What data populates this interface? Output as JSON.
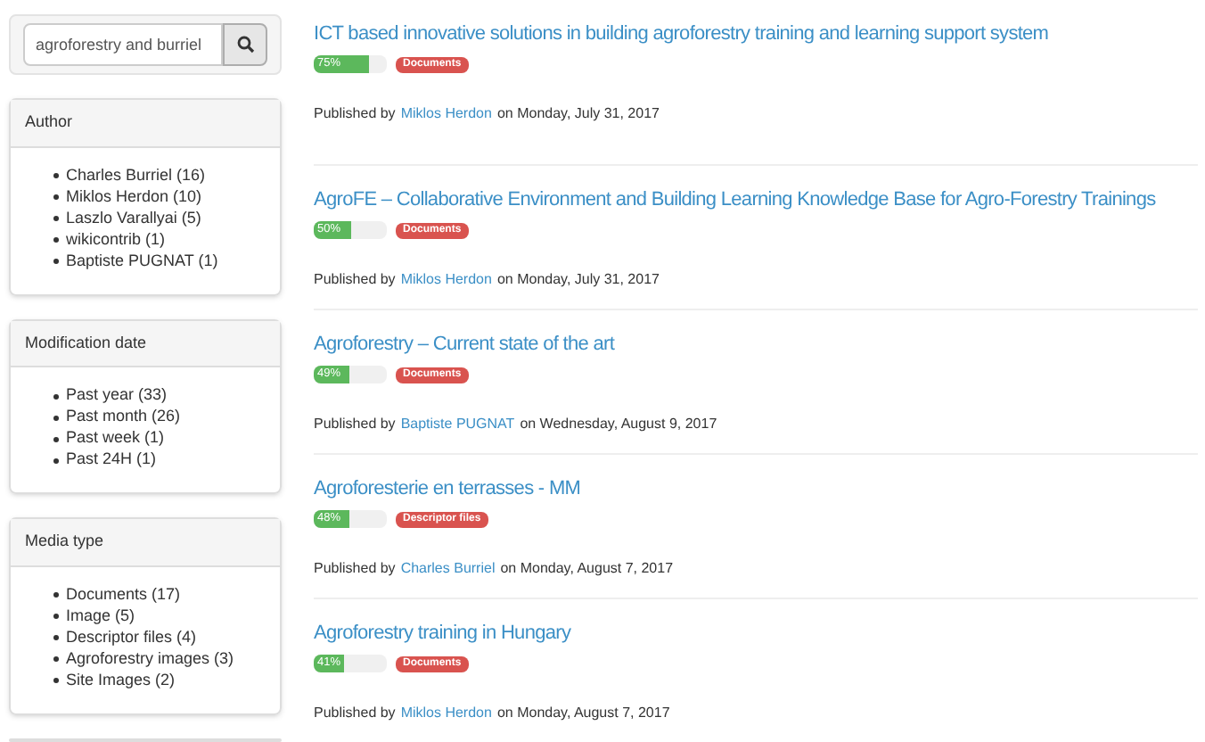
{
  "search": {
    "value": "agroforestry and burriel"
  },
  "facets": [
    {
      "title": "Author",
      "items": [
        "Charles Burriel (16)",
        "Miklos Herdon (10)",
        "Laszlo Varallyai (5)",
        "wikicontrib (1)",
        "Baptiste PUGNAT (1)"
      ]
    },
    {
      "title": "Modification date",
      "items": [
        "Past year (33)",
        "Past month (26)",
        "Past week (1)",
        "Past 24H (1)"
      ]
    },
    {
      "title": "Media type",
      "items": [
        "Documents (17)",
        "Image (5)",
        "Descriptor files (4)",
        "Agroforestry images (3)",
        "Site Images (2)"
      ]
    }
  ],
  "results": [
    {
      "title": "ICT based innovative solutions in building agroforestry training and learning support system",
      "score": "75%",
      "level": 0.75,
      "tag": "Documents",
      "prefix": "Published by",
      "author": "Miklos Herdon",
      "date": "on Monday, July 31, 2017"
    },
    {
      "title": "AgroFE – Collaborative Environment and Building Learning Knowledge Base for Agro-Forestry Trainings",
      "score": "50%",
      "level": 0.5,
      "tag": "Documents",
      "prefix": "Published by",
      "author": "Miklos Herdon",
      "date": "on Monday, July 31, 2017"
    },
    {
      "title": "Agroforestry – Current state of the art",
      "score": "49%",
      "level": 0.49,
      "tag": "Documents",
      "prefix": "Published by",
      "author": "Baptiste PUGNAT",
      "date": "on Wednesday, August 9, 2017"
    },
    {
      "title": "Agroforesterie en terrasses - MM",
      "score": "48%",
      "level": 0.48,
      "tag": "Descriptor files",
      "prefix": "Published by",
      "author": "Charles Burriel",
      "date": "on Monday, August 7, 2017"
    },
    {
      "title": "Agroforestry training in Hungary",
      "score": "41%",
      "level": 0.41,
      "tag": "Documents",
      "prefix": "Published by",
      "author": "Miklos Herdon",
      "date": "on Monday, August 7, 2017"
    }
  ]
}
